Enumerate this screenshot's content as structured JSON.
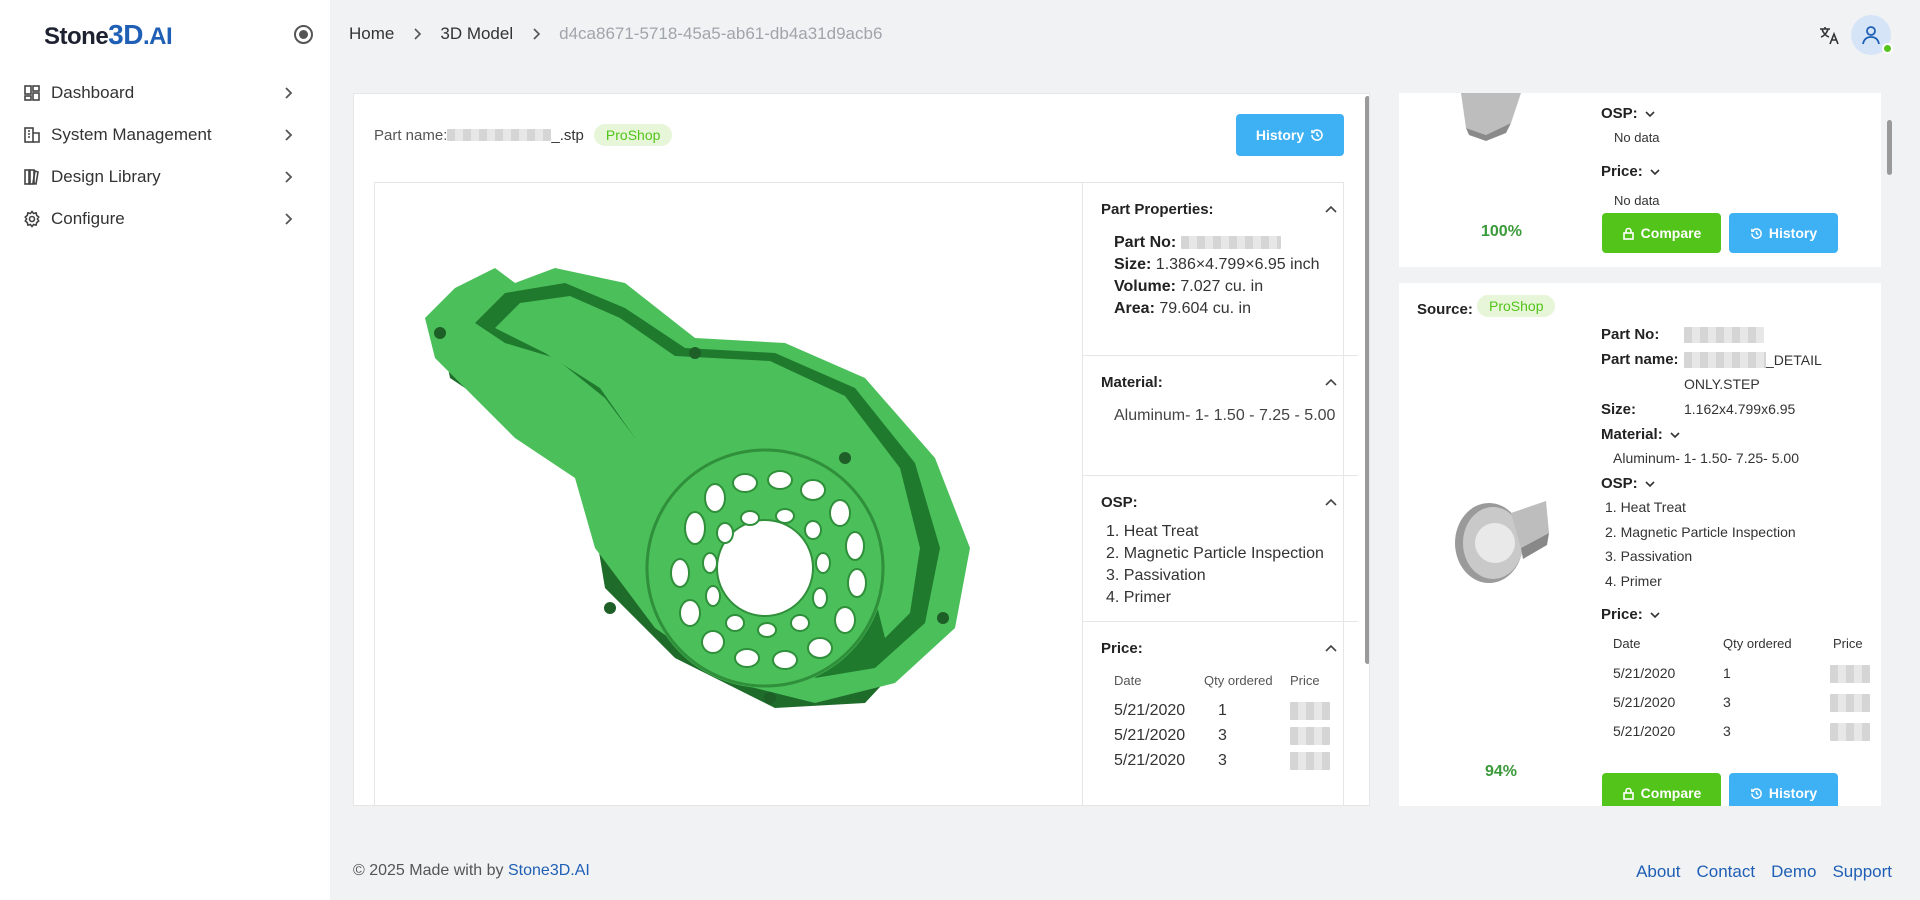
{
  "brand": {
    "part1": "Stone",
    "part2": "3D",
    "part3": ".AI"
  },
  "sidebar": {
    "items": [
      {
        "label": "Dashboard",
        "icon": "dashboard-icon"
      },
      {
        "label": "System Management",
        "icon": "building-icon"
      },
      {
        "label": "Design Library",
        "icon": "library-icon"
      },
      {
        "label": "Configure",
        "icon": "gear-icon"
      }
    ]
  },
  "breadcrumb": {
    "home": "Home",
    "model": "3D Model",
    "id": "d4ca8671-5718-45a5-ab61-db4a31d9acb6"
  },
  "part": {
    "name_label": "Part name:",
    "name_suffix": "_.stp",
    "source_tag": "ProShop",
    "history_label": "History",
    "model_color": "#4bbf5a"
  },
  "properties": {
    "part_props_title": "Part Properties:",
    "part_no_label": "Part No:",
    "size_label": "Size:",
    "size_value": "1.386×4.799×6.95 inch",
    "volume_label": "Volume:",
    "volume_value": "7.027 cu. in",
    "area_label": "Area:",
    "area_value": "79.604 cu. in",
    "material_title": "Material:",
    "material_value": "Aluminum- 1- 1.50 - 7.25 - 5.00",
    "osp_title": "OSP:",
    "osp_items": [
      "1. Heat Treat",
      "2. Magnetic Particle Inspection",
      "3. Passivation",
      "4. Primer"
    ],
    "price_title": "Price:",
    "price_headers": {
      "date": "Date",
      "qty": "Qty ordered",
      "price": "Price"
    },
    "price_rows": [
      {
        "date": "5/21/2020",
        "qty": "1"
      },
      {
        "date": "5/21/2020",
        "qty": "3"
      },
      {
        "date": "5/21/2020",
        "qty": "3"
      }
    ]
  },
  "results": {
    "card1": {
      "osp_label": "OSP:",
      "osp_value": "No data",
      "price_label": "Price:",
      "price_value": "No data",
      "match": "100%",
      "compare_label": "Compare",
      "history_label": "History"
    },
    "card2": {
      "source_label": "Source:",
      "source_tag": "ProShop",
      "part_no_label": "Part No:",
      "part_name_label": "Part name:",
      "part_name_suffix": "_DETAIL",
      "part_name_line2": "ONLY.STEP",
      "size_label": "Size:",
      "size_value": "1.162x4.799x6.95",
      "material_label": "Material:",
      "material_value": "Aluminum- 1- 1.50- 7.25- 5.00",
      "osp_label": "OSP:",
      "osp_items": [
        "1. Heat Treat",
        "2. Magnetic Particle Inspection",
        "3. Passivation",
        "4. Primer"
      ],
      "price_label": "Price:",
      "price_headers": {
        "date": "Date",
        "qty": "Qty ordered",
        "price": "Price"
      },
      "price_rows": [
        {
          "date": "5/21/2020",
          "qty": "1"
        },
        {
          "date": "5/21/2020",
          "qty": "3"
        },
        {
          "date": "5/21/2020",
          "qty": "3"
        }
      ],
      "match": "94%",
      "compare_label": "Compare",
      "history_label": "History"
    }
  },
  "footer": {
    "copyright": "© 2025 Made with by",
    "brand": "Stone3D.AI",
    "links": [
      "About",
      "Contact",
      "Demo",
      "Support"
    ]
  }
}
